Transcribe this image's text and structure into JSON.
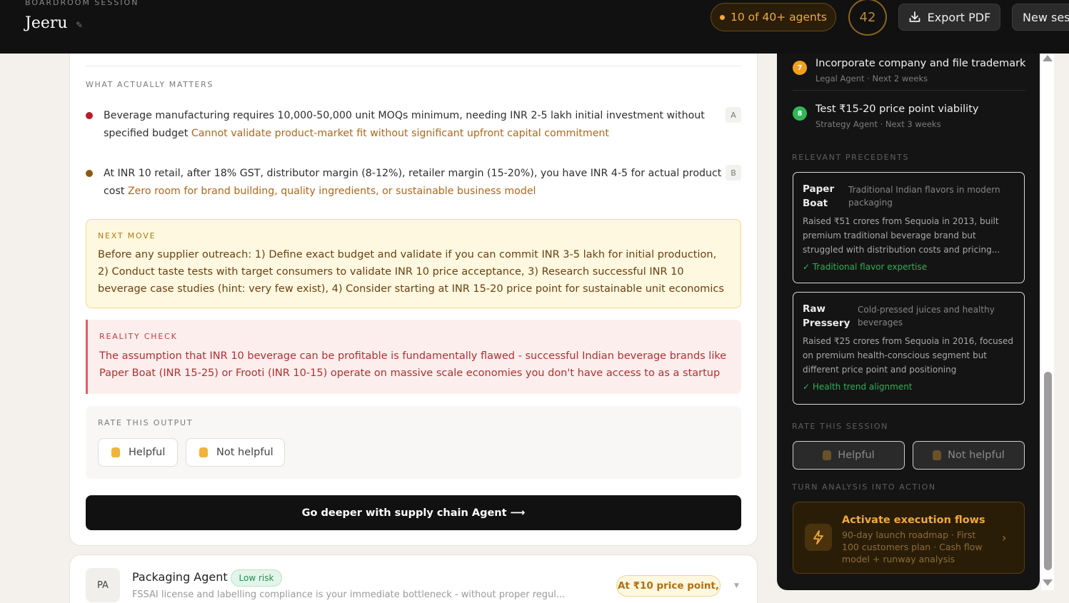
{
  "header": {
    "session_label": "BOARDROOM SESSION",
    "brand": "Jeeru",
    "edit_icon": "pencil-icon",
    "agents_pill": "10 of 40+ agents",
    "score": "42",
    "export_label": "Export PDF",
    "new_session_label": "New session"
  },
  "main": {
    "matters_label": "WHAT ACTUALLY MATTERS",
    "matters": [
      {
        "text": "Beverage manufacturing requires 10,000-50,000 unit MOQs minimum, needing INR 2-5 lakh initial investment without specified budget ",
        "emphasis": "Cannot validate product-market fit without significant upfront capital commitment",
        "tag": "A",
        "bullet_color": "#b41e2a"
      },
      {
        "text": "At INR 10 retail, after 18% GST, distributor margin (8-12%), retailer margin (15-20%), you have INR 4-5 for actual product cost ",
        "emphasis": "Zero room for brand building, quality ingredients, or sustainable business model",
        "tag": "B",
        "bullet_color": "#8a5a14"
      }
    ],
    "next_move": {
      "label": "NEXT MOVE",
      "body": "Before any supplier outreach: 1) Define exact budget and validate if you can commit INR 3-5 lakh for initial production, 2) Conduct taste tests with target consumers to validate INR 10 price acceptance, 3) Research successful INR 10 beverage case studies (hint: very few exist), 4) Consider starting at INR 15-20 price point for sustainable unit economics"
    },
    "reality_check": {
      "label": "REALITY CHECK",
      "body": "The assumption that INR 10 beverage can be profitable is fundamentally flawed - successful Indian beverage brands like Paper Boat (INR 15-25) or Frooti (INR 10-15) operate on massive scale economies you don't have access to as a startup"
    },
    "rate": {
      "label": "RATE THIS OUTPUT",
      "helpful": "Helpful",
      "not_helpful": "Not helpful"
    },
    "deeper_button": "Go deeper with supply chain Agent ⟶"
  },
  "agent_card": {
    "avatar": "PA",
    "name": "Packaging Agent",
    "risk": "Low risk",
    "summary": "FSSAI license and labelling compliance is your immediate bottleneck - without proper regul...",
    "price_pill": "At ₹10 price point,"
  },
  "right_panel": {
    "steps": [
      {
        "num": "7",
        "title": "Incorporate company and file trademark",
        "meta": "Legal Agent · Next 2 weeks",
        "color": "#f0a020"
      },
      {
        "num": "8",
        "title": "Test ₹15-20 price point viability",
        "meta": "Strategy Agent · Next 3 weeks",
        "color": "#2fb855"
      }
    ],
    "precedents_label": "RELEVANT PRECEDENTS",
    "precedents": [
      {
        "name_line1": "Paper",
        "name_line2": "Boat",
        "desc": "Traditional Indian flavors in modern packaging",
        "body": "Raised ₹51 crores from Sequoia in 2013, built premium traditional beverage brand but struggled with distribution costs and pricing...",
        "check": "✓ Traditional flavor expertise"
      },
      {
        "name_line1": "Raw",
        "name_line2": "Pressery",
        "desc": "Cold-pressed juices and healthy beverages",
        "body": "Raised ₹25 crores from Sequoia in 2016, focused on premium health-conscious segment but different price point and positioning",
        "check": "✓ Health trend alignment"
      }
    ],
    "rate_label": "RATE THIS SESSION",
    "helpful": "Helpful",
    "not_helpful": "Not helpful",
    "action_label": "TURN ANALYSIS INTO ACTION",
    "activate_title": "Activate execution flows",
    "activate_desc": "90-day launch roadmap · First 100 customers plan · Cash flow model + runway analysis"
  }
}
